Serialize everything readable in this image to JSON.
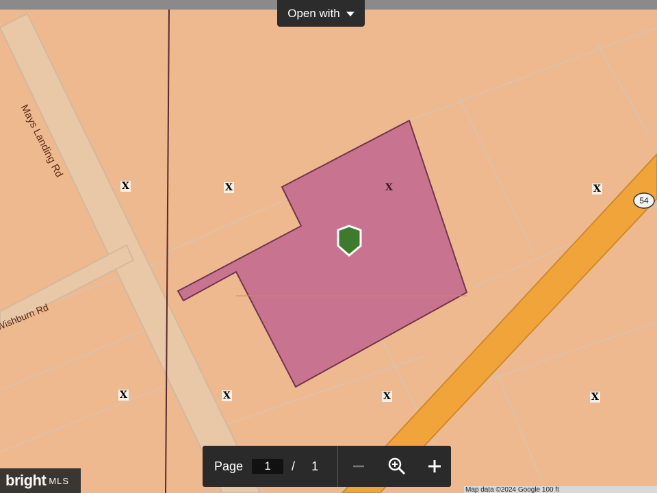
{
  "toolbar": {
    "open_with_label": "Open with"
  },
  "map": {
    "roads": [
      "Mays Landing Rd",
      "Wishburn Rd"
    ],
    "route_shield": "54",
    "parcel_markers": [
      "X",
      "X",
      "X",
      "X",
      "X",
      "X",
      "X",
      "X"
    ],
    "colors": {
      "background": "#eeb98f",
      "parcel": "#c7708f",
      "highway": "#f0a43a",
      "pin": "#3d7a2e"
    }
  },
  "pager": {
    "page_label": "Page",
    "current_page": "1",
    "separator": "/",
    "total_pages": "1"
  },
  "icons": {
    "zoom_out": "minus-icon",
    "zoom_reset": "zoom-icon",
    "zoom_in": "plus-icon"
  },
  "branding": {
    "brand": "bright",
    "suffix": "MLS"
  },
  "attribution": "Map data ©2024 Google   100 ft"
}
